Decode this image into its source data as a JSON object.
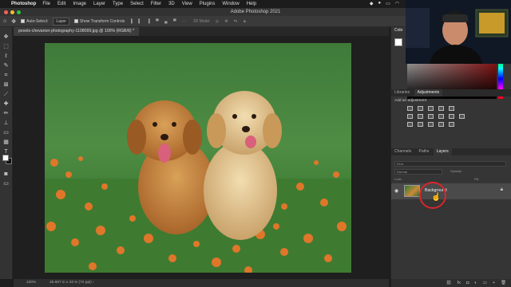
{
  "menubar": {
    "app": "Photoshop",
    "items": [
      "File",
      "Edit",
      "Image",
      "Layer",
      "Type",
      "Select",
      "Filter",
      "3D",
      "View",
      "Plugins",
      "Window",
      "Help"
    ]
  },
  "titlebar": {
    "title": "Adobe Photoshop 2021"
  },
  "options": {
    "auto_select_label": "Auto-Select:",
    "auto_select_value": "Layer",
    "show_transform_label": "Show Transform Controls",
    "mode_3d": "3D Mode:"
  },
  "document": {
    "tab_label": "pexels-chevanon-photography-1108099.jpg @ 100% (RGB/8) *",
    "zoom": "100%",
    "dimensions": "26.667 in x 20 in (72 ppi)"
  },
  "right_panels": {
    "color_tab": "Colo",
    "tabs_mid": [
      "Libraries",
      "Adjustments"
    ],
    "adjustments_label": "Add an adjustment",
    "tabs_layers": [
      "Channels",
      "Paths",
      "Layers"
    ],
    "kind_placeholder": "Kind",
    "blend_mode": "Normal",
    "opacity_label": "Opacity:",
    "lock_label": "Lock:",
    "fill_label": "Fill:",
    "layer_name": "Background"
  },
  "colors": {
    "highlight": "#d8262b",
    "accent_red": "#e02020"
  }
}
